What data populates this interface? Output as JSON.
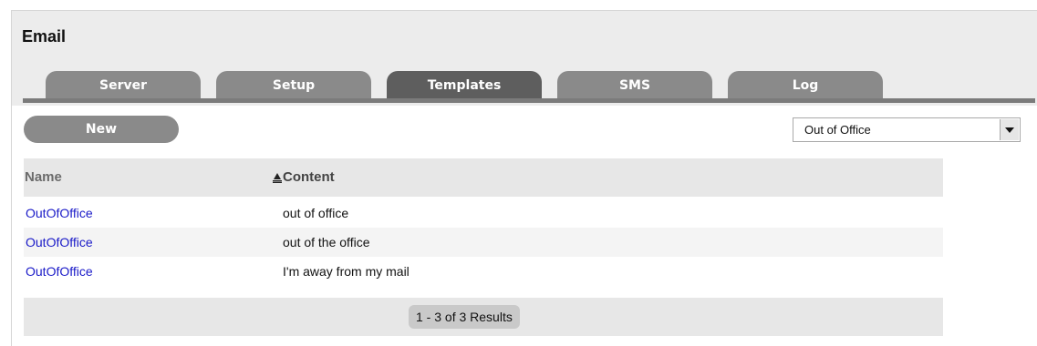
{
  "window": {
    "title": "Email"
  },
  "tabs": [
    {
      "label": "Server",
      "active": false
    },
    {
      "label": "Setup",
      "active": false
    },
    {
      "label": "Templates",
      "active": true
    },
    {
      "label": "SMS",
      "active": false
    },
    {
      "label": "Log",
      "active": false
    }
  ],
  "toolbar": {
    "new_label": "New"
  },
  "filter": {
    "selected": "Out of Office"
  },
  "table": {
    "columns": {
      "name": "Name",
      "content": "Content"
    },
    "rows": [
      {
        "name": "OutOfOffice",
        "content": "out of office"
      },
      {
        "name": "OutOfOffice",
        "content": "out of the office"
      },
      {
        "name": "OutOfOffice",
        "content": "I'm away from my mail"
      }
    ]
  },
  "pagination": {
    "results": "1 - 3 of 3 Results"
  },
  "colors": {
    "tab": "#8a8a8a",
    "tab_active": "#5e5e5e",
    "link": "#1a1ac8",
    "header_bg": "#ececec"
  },
  "icons": {
    "sort": "sort-ascending-icon",
    "dropdown": "chevron-down-icon"
  }
}
